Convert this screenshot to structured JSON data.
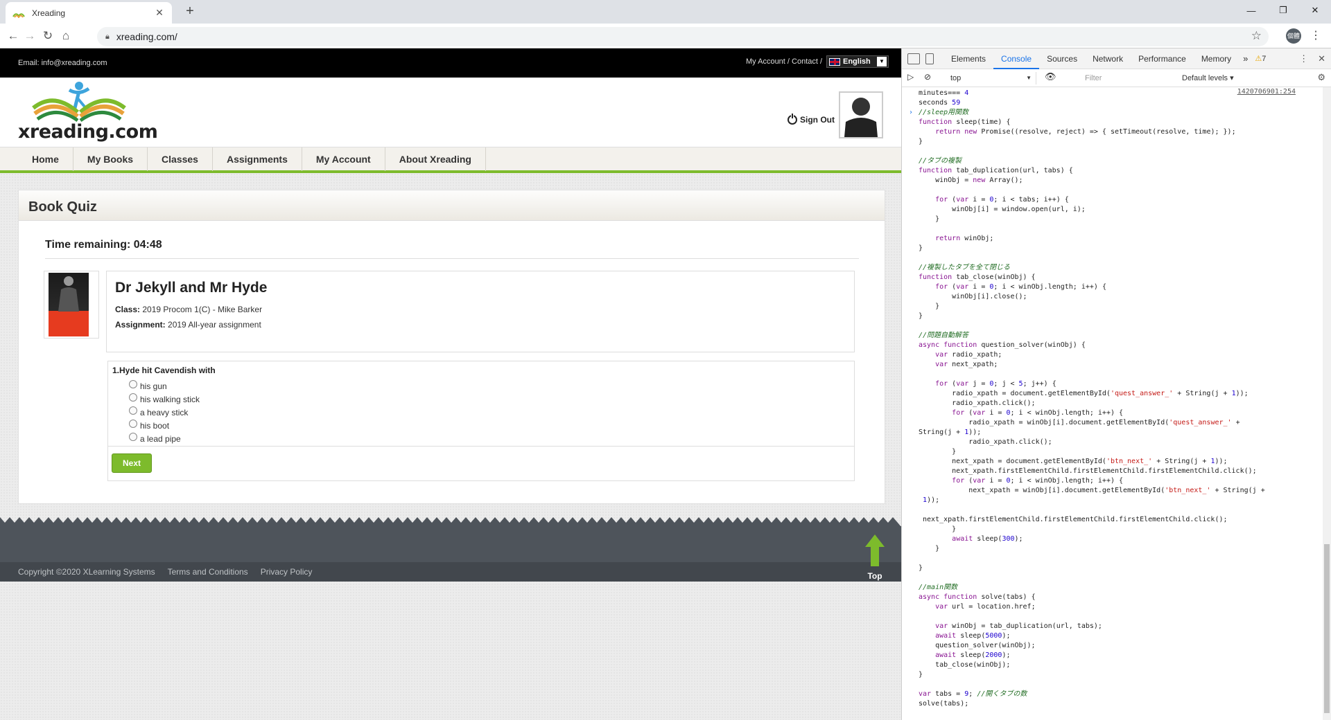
{
  "browser": {
    "tab_title": "Xreading",
    "url": "xreading.com/",
    "profile_label": "個體"
  },
  "site": {
    "email": "Email: info@xreading.com",
    "top_links": "My Account / Contact /",
    "language": "English",
    "logo_text": "xreading.com",
    "sign_out": "Sign Out",
    "nav": [
      "Home",
      "My Books",
      "Classes",
      "Assignments",
      "My Account",
      "About Xreading"
    ]
  },
  "quiz": {
    "panel_title": "Book Quiz",
    "time_remaining": "Time remaining: 04:48",
    "book_title": "Dr Jekyll and Mr Hyde",
    "class_label": "Class:",
    "class_value": "2019 Procom 1(C) - Mike Barker",
    "assignment_label": "Assignment:",
    "assignment_value": "2019 All-year assignment",
    "question": "1.Hyde hit Cavendish with",
    "options": [
      "his gun",
      "his walking stick",
      "a heavy stick",
      "his boot",
      "a lead pipe"
    ],
    "next_label": "Next"
  },
  "footer": {
    "copyright": "Copyright ©2020 XLearning Systems",
    "terms": "Terms and Conditions",
    "privacy": "Privacy Policy",
    "top_label": "Top"
  },
  "devtools": {
    "tabs": [
      "Elements",
      "Console",
      "Sources",
      "Network",
      "Performance",
      "Memory"
    ],
    "active_tab": "Console",
    "warning_count": "7",
    "context": "top",
    "filter_placeholder": "Filter",
    "levels": "Default levels ▾",
    "source_link": "1420706901:254",
    "console_lines": [
      "minutes=== 4",
      "seconds 59",
      "//sleep用関数",
      "function sleep(time) {",
      "    return new Promise((resolve, reject) => { setTimeout(resolve, time); });",
      "}",
      "",
      "//タブの複製",
      "function tab_duplication(url, tabs) {",
      "    winObj = new Array();",
      "",
      "    for (var i = 0; i < tabs; i++) {",
      "        winObj[i] = window.open(url, i);",
      "    }",
      "",
      "    return winObj;",
      "}",
      "",
      "//複製したタブを全て閉じる",
      "function tab_close(winObj) {",
      "    for (var i = 0; i < winObj.length; i++) {",
      "        winObj[i].close();",
      "    }",
      "}",
      "",
      "//問題自動解答",
      "async function question_solver(winObj) {",
      "    var radio_xpath;",
      "    var next_xpath;",
      "",
      "    for (var j = 0; j < 5; j++) {",
      "        radio_xpath = document.getElementById('quest_answer_' + String(j + 1));",
      "        radio_xpath.click();",
      "        for (var i = 0; i < winObj.length; i++) {",
      "            radio_xpath = winObj[i].document.getElementById('quest_answer_' +",
      "String(j + 1));",
      "            radio_xpath.click();",
      "        }",
      "        next_xpath = document.getElementById('btn_next_' + String(j + 1));",
      "        next_xpath.firstElementChild.firstElementChild.firstElementChild.click();",
      "        for (var i = 0; i < winObj.length; i++) {",
      "            next_xpath = winObj[i].document.getElementById('btn_next_' + String(j +",
      " 1));",
      "",
      " next_xpath.firstElementChild.firstElementChild.firstElementChild.click();",
      "        }",
      "        await sleep(300);",
      "    }",
      "",
      "}",
      "",
      "//main関数",
      "async function solve(tabs) {",
      "    var url = location.href;",
      "",
      "    var winObj = tab_duplication(url, tabs);",
      "    await sleep(5000);",
      "    question_solver(winObj);",
      "    await sleep(2000);",
      "    tab_close(winObj);",
      "}",
      "",
      "var tabs = 9; //開くタブの数",
      "solve(tabs);"
    ]
  }
}
